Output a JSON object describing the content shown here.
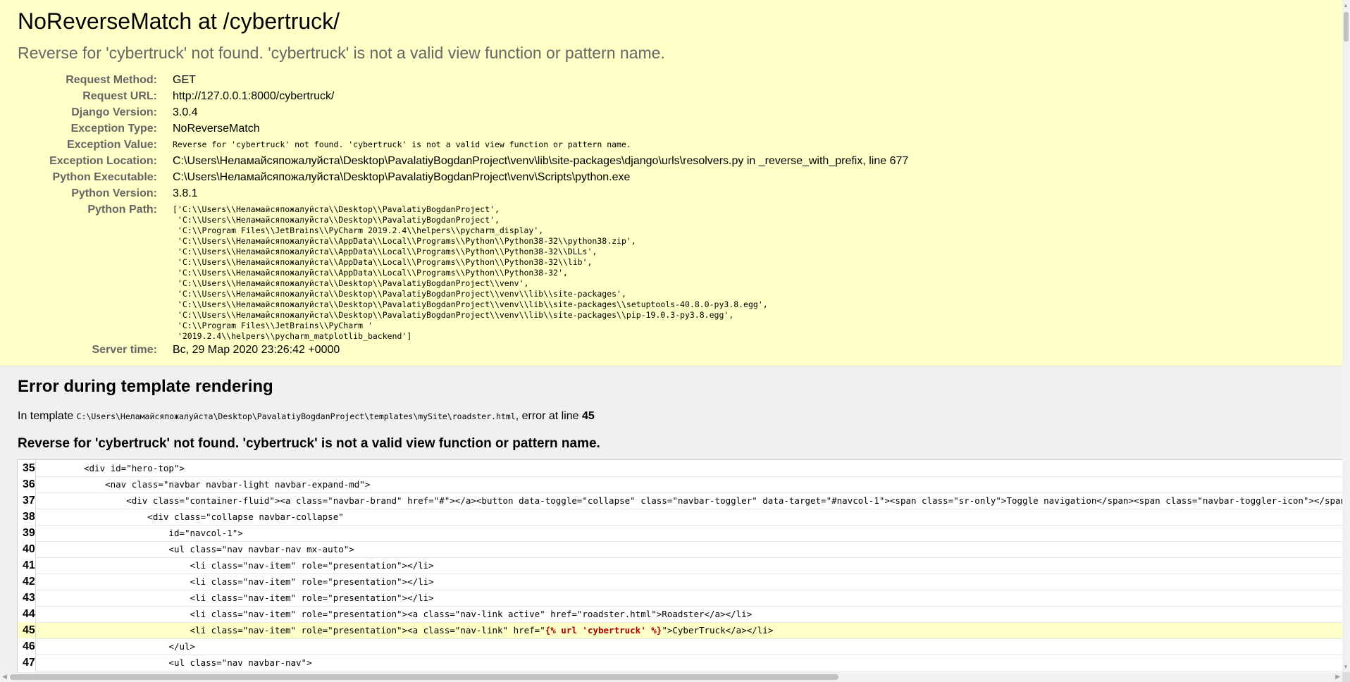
{
  "summary": {
    "title": "NoReverseMatch at /cybertruck/",
    "message": "Reverse for 'cybertruck' not found. 'cybertruck' is not a valid view function or pattern name.",
    "meta": [
      {
        "label": "Request Method:",
        "value": "GET"
      },
      {
        "label": "Request URL:",
        "value": "http://127.0.0.1:8000/cybertruck/"
      },
      {
        "label": "Django Version:",
        "value": "3.0.4"
      },
      {
        "label": "Exception Type:",
        "value": "NoReverseMatch"
      },
      {
        "label": "Exception Value:",
        "value": "Reverse for 'cybertruck' not found. 'cybertruck' is not a valid view function or pattern name."
      },
      {
        "label": "Exception Location:",
        "value": "C:\\Users\\Неламайсяпожалуйста\\Desktop\\PavalatiyBogdanProject\\venv\\lib\\site-packages\\django\\urls\\resolvers.py in _reverse_with_prefix, line 677"
      },
      {
        "label": "Python Executable:",
        "value": "C:\\Users\\Неламайсяпожалуйста\\Desktop\\PavalatiyBogdanProject\\venv\\Scripts\\python.exe"
      },
      {
        "label": "Python Version:",
        "value": "3.8.1"
      },
      {
        "label": "Python Path:",
        "value": ""
      },
      {
        "label": "Server time:",
        "value": "Вс, 29 Мар 2020 23:26:42 +0000"
      }
    ],
    "python_path": [
      "['C:\\\\Users\\\\Неламайсяпожалуйста\\\\Desktop\\\\PavalatiyBogdanProject',",
      " 'C:\\\\Users\\\\Неламайсяпожалуйста\\\\Desktop\\\\PavalatiyBogdanProject',",
      " 'C:\\\\Program Files\\\\JetBrains\\\\PyCharm 2019.2.4\\\\helpers\\\\pycharm_display',",
      " 'C:\\\\Users\\\\Неламайсяпожалуйста\\\\AppData\\\\Local\\\\Programs\\\\Python\\\\Python38-32\\\\python38.zip',",
      " 'C:\\\\Users\\\\Неламайсяпожалуйста\\\\AppData\\\\Local\\\\Programs\\\\Python\\\\Python38-32\\\\DLLs',",
      " 'C:\\\\Users\\\\Неламайсяпожалуйста\\\\AppData\\\\Local\\\\Programs\\\\Python\\\\Python38-32\\\\lib',",
      " 'C:\\\\Users\\\\Неламайсяпожалуйста\\\\AppData\\\\Local\\\\Programs\\\\Python\\\\Python38-32',",
      " 'C:\\\\Users\\\\Неламайсяпожалуйста\\\\Desktop\\\\PavalatiyBogdanProject\\\\venv',",
      " 'C:\\\\Users\\\\Неламайсяпожалуйста\\\\Desktop\\\\PavalatiyBogdanProject\\\\venv\\\\lib\\\\site-packages',",
      " 'C:\\\\Users\\\\Неламайсяпожалуйста\\\\Desktop\\\\PavalatiyBogdanProject\\\\venv\\\\lib\\\\site-packages\\\\setuptools-40.8.0-py3.8.egg',",
      " 'C:\\\\Users\\\\Неламайсяпожалуйста\\\\Desktop\\\\PavalatiyBogdanProject\\\\venv\\\\lib\\\\site-packages\\\\pip-19.0.3-py3.8.egg',",
      " 'C:\\\\Program Files\\\\JetBrains\\\\PyCharm '",
      " '2019.2.4\\\\helpers\\\\pycharm_matplotlib_backend']"
    ]
  },
  "template": {
    "heading": "Error during template rendering",
    "in_template_prefix": "In template ",
    "template_path": "C:\\Users\\Неламайсяпожалуйста\\Desktop\\PavalatiyBogdanProject\\templates\\mySite\\roadster.html",
    "error_at_line_text": ", error at line ",
    "error_line": "45",
    "message": "Reverse for 'cybertruck' not found. 'cybertruck' is not a valid view function or pattern name.",
    "source_lines": [
      {
        "num": "35",
        "code": "        <div id=\"hero-top\">"
      },
      {
        "num": "36",
        "code": "            <nav class=\"navbar navbar-light navbar-expand-md\">"
      },
      {
        "num": "37",
        "code": "                <div class=\"container-fluid\"><a class=\"navbar-brand\" href=\"#\"></a><button data-toggle=\"collapse\" class=\"navbar-toggler\" data-target=\"#navcol-1\"><span class=\"sr-only\">Toggle navigation</span><span class=\"navbar-toggler-icon\"></span></button>"
      },
      {
        "num": "38",
        "code": "                    <div class=\"collapse navbar-collapse\""
      },
      {
        "num": "39",
        "code": "                        id=\"navcol-1\">"
      },
      {
        "num": "40",
        "code": "                        <ul class=\"nav navbar-nav mx-auto\">"
      },
      {
        "num": "41",
        "code": "                            <li class=\"nav-item\" role=\"presentation\"></li>"
      },
      {
        "num": "42",
        "code": "                            <li class=\"nav-item\" role=\"presentation\"></li>"
      },
      {
        "num": "43",
        "code": "                            <li class=\"nav-item\" role=\"presentation\"></li>"
      },
      {
        "num": "44",
        "code": "                            <li class=\"nav-item\" role=\"presentation\"><a class=\"nav-link active\" href=\"roadster.html\">Roadster</a></li>"
      },
      {
        "num": "45",
        "code_before": "                            <li class=\"nav-item\" role=\"presentation\"><a class=\"nav-link\" href=\"",
        "code_highlight": "{% url 'cybertruck' %}",
        "code_after": "\">CyberTruck</a></li>",
        "error": true
      },
      {
        "num": "46",
        "code": "                        </ul>"
      },
      {
        "num": "47",
        "code": "                        <ul class=\"nav navbar-nav\">"
      }
    ]
  },
  "colors": {
    "summary_bg": "#ffffc8",
    "page_bg": "#f0f0f0",
    "highlight_text": "#a80000"
  }
}
